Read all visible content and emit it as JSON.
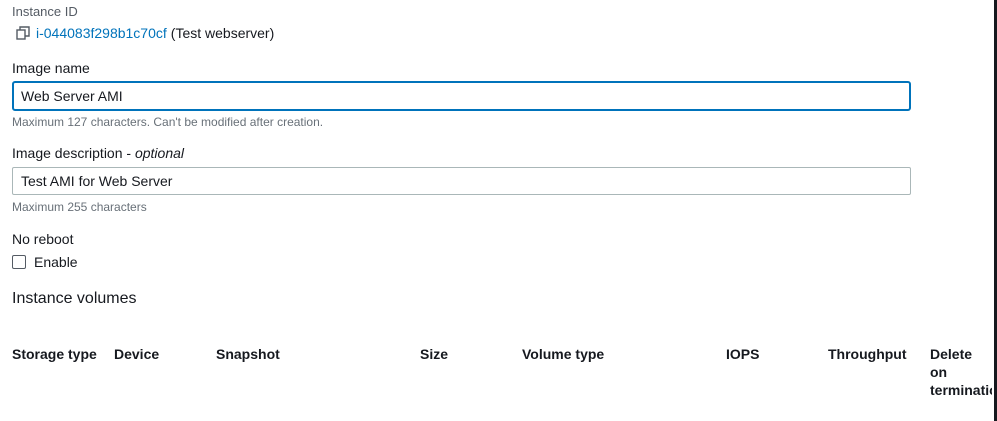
{
  "instance": {
    "label": "Instance ID",
    "id": "i-044083f298b1c70cf",
    "name": "(Test webserver)"
  },
  "image_name": {
    "label": "Image name",
    "value": "Web Server AMI",
    "constraint": "Maximum 127 characters. Can't be modified after creation."
  },
  "image_description": {
    "label": "Image description",
    "optional_separator": " - ",
    "optional": "optional",
    "value": "Test AMI for Web Server",
    "constraint": "Maximum 255 characters"
  },
  "no_reboot": {
    "label": "No reboot",
    "checkbox_label": "Enable",
    "checked": false
  },
  "volumes": {
    "title": "Instance volumes",
    "columns": [
      "Storage type",
      "Device",
      "Snapshot",
      "Size",
      "Volume type",
      "IOPS",
      "Throughput",
      "Delete on termination"
    ]
  },
  "colors": {
    "link": "#0073bb",
    "focus_border": "#0073bb",
    "muted_text": "#545b64"
  }
}
